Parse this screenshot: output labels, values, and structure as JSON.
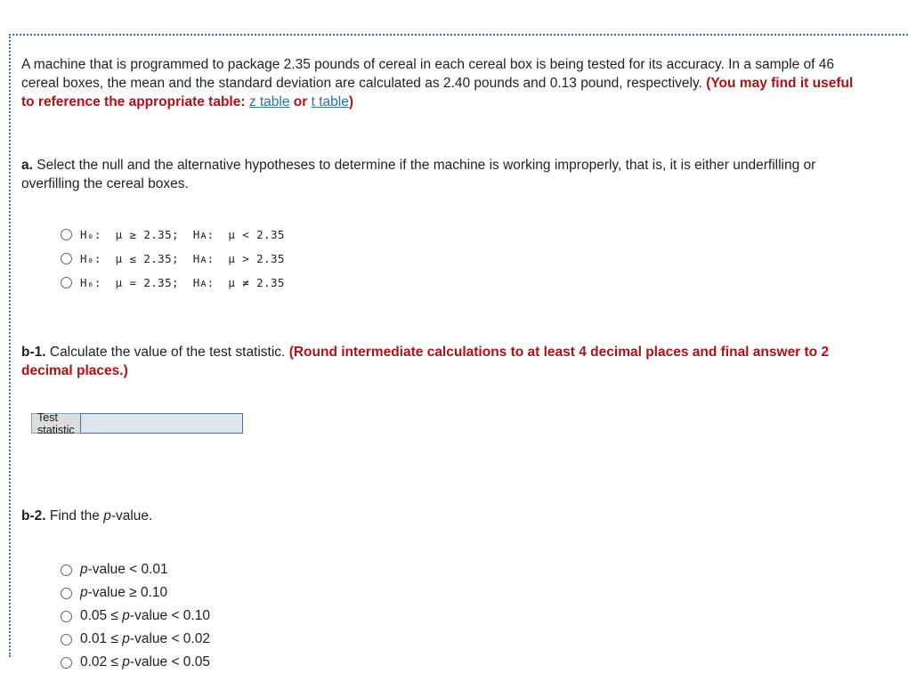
{
  "question": {
    "stem": {
      "text_part_1": "A machine that is programmed to package 2.35 pounds of cereal in each cereal box is being tested for its accuracy. In a sample of 46 cereal boxes, the mean and the standard deviation are calculated as 2.40 pounds and 0.13 pound, respectively. ",
      "hint_open": "(You may find it useful to reference the appropriate table: ",
      "link_z": "z table",
      "hint_or": " or ",
      "link_t": "t table",
      "hint_close": ")",
      "target_weight": "2.35",
      "sample_size": "46",
      "sample_mean": "2.40",
      "sample_sd": "0.13"
    },
    "part_a": {
      "label": "a.",
      "text": " Select the null and the alternative hypotheses to determine if the machine is working improperly, that is, it is either underfilling or overfilling the cereal boxes.",
      "options": [
        {
          "h0_sym": "≥",
          "h0_val": "2.35",
          "ha_sym": "<",
          "ha_val": "2.35"
        },
        {
          "h0_sym": "≤",
          "h0_val": "2.35",
          "ha_sym": ">",
          "ha_val": "2.35"
        },
        {
          "h0_sym": "=",
          "h0_val": "2.35",
          "ha_sym": "≠",
          "ha_val": "2.35"
        }
      ],
      "option_texts": [
        "H₀:  μ ≥ 2.35;  Hᴀ:  μ < 2.35",
        "H₀:  μ ≤ 2.35;  Hᴀ:  μ > 2.35",
        "H₀:  μ = 2.35;  Hᴀ:  μ ≠ 2.35"
      ]
    },
    "part_b1": {
      "label": "b-1.",
      "text": " Calculate the value of the test statistic. ",
      "rounding_note": "(Round intermediate calculations to at least 4 decimal places and final answer to 2 decimal places.)",
      "answer_label": "Test statistic",
      "answer_value": "",
      "answer_placeholder": ""
    },
    "part_b2": {
      "label": "b-2.",
      "text_before_italic": " Find the ",
      "italic": "p",
      "text_after_italic": "-value.",
      "options": [
        {
          "prefix": "",
          "italic": "p",
          "suffix": "-value < 0.01"
        },
        {
          "prefix": "",
          "italic": "p",
          "suffix": "-value ≥ 0.10"
        },
        {
          "prefix": "0.05 ≤ ",
          "italic": "p",
          "suffix": "-value < 0.10"
        },
        {
          "prefix": "0.01 ≤ ",
          "italic": "p",
          "suffix": "-value < 0.02"
        },
        {
          "prefix": "0.02 ≤ ",
          "italic": "p",
          "suffix": "-value < 0.05"
        }
      ]
    }
  },
  "colors": {
    "red_highlight": "#b01116",
    "link_blue": "#2f6fa8",
    "frame_dotted": "#3d6ea8",
    "input_fill": "#dde4ee",
    "input_border": "#50719e",
    "label_fill": "#dcdcdc"
  }
}
